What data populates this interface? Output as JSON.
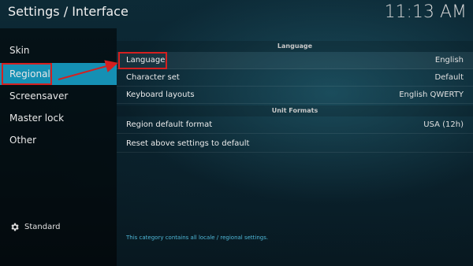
{
  "header": {
    "title": "Settings / Interface",
    "time": "11:13 AM"
  },
  "sidebar": {
    "items": [
      {
        "label": "Skin"
      },
      {
        "label": "Regional"
      },
      {
        "label": "Screensaver"
      },
      {
        "label": "Master lock"
      },
      {
        "label": "Other"
      }
    ],
    "active_index": 1,
    "level_label": "Standard"
  },
  "panel": {
    "sections": [
      {
        "title": "Language",
        "rows": [
          {
            "label": "Language",
            "value": "English"
          },
          {
            "label": "Character set",
            "value": "Default"
          },
          {
            "label": "Keyboard layouts",
            "value": "English QWERTY"
          }
        ]
      },
      {
        "title": "Unit Formats",
        "rows": [
          {
            "label": "Region default format",
            "value": "USA (12h)"
          },
          {
            "label": "Reset above settings to default",
            "value": ""
          }
        ]
      }
    ],
    "hint": "This category contains all locale / regional settings."
  },
  "colors": {
    "accent": "#1590b4",
    "highlight_box": "#d42020",
    "hint_text": "#4fb8d8"
  }
}
